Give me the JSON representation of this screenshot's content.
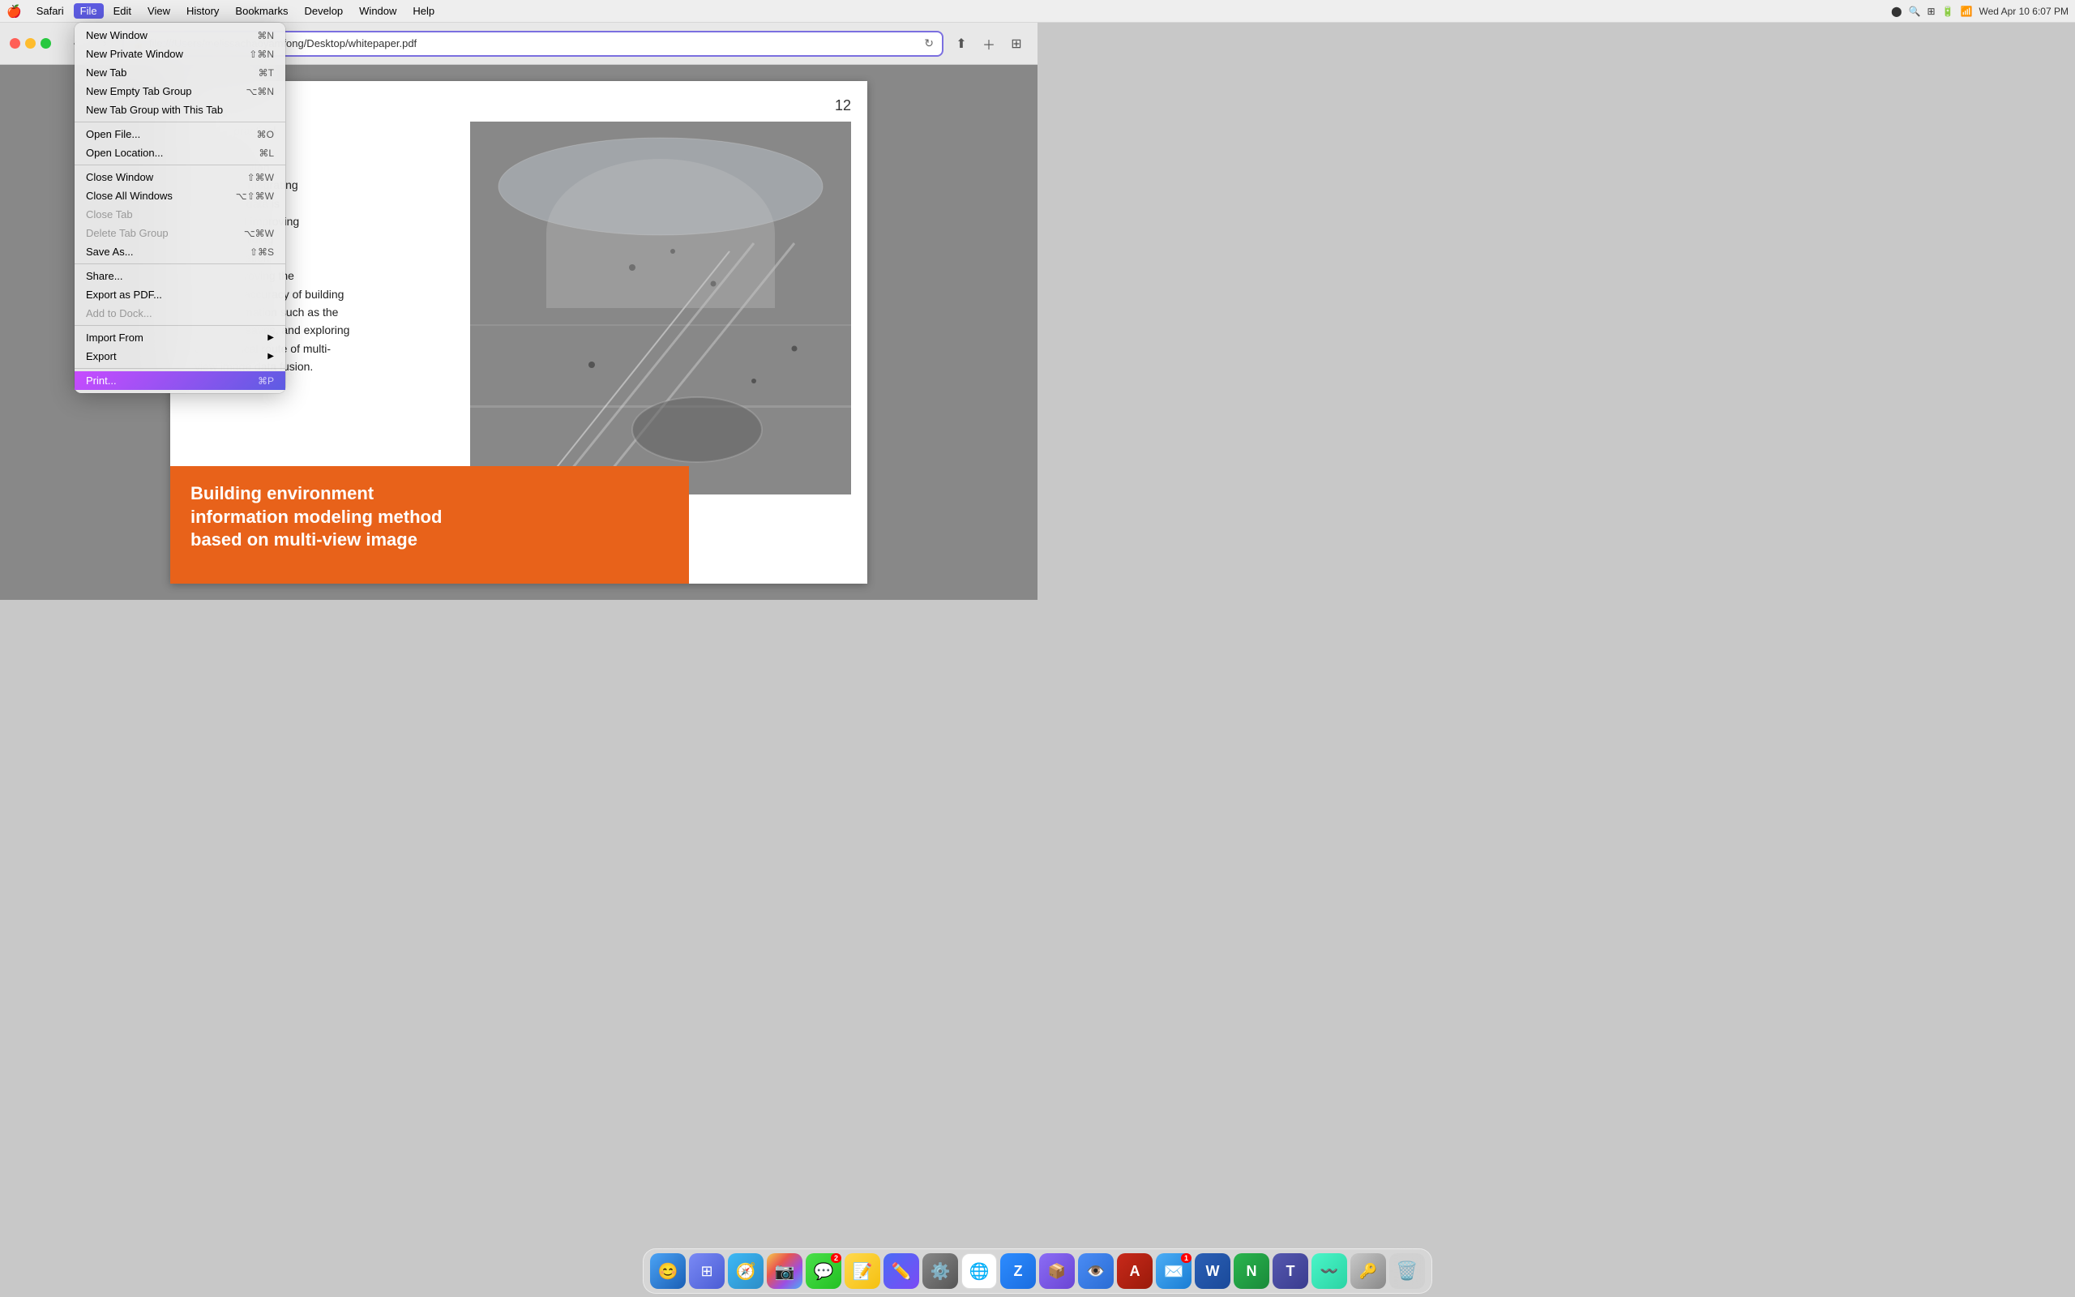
{
  "menubar": {
    "apple": "🍎",
    "items": [
      {
        "label": "Safari",
        "active": false
      },
      {
        "label": "File",
        "active": true
      },
      {
        "label": "Edit",
        "active": false
      },
      {
        "label": "View",
        "active": false
      },
      {
        "label": "History",
        "active": false
      },
      {
        "label": "Bookmarks",
        "active": false
      },
      {
        "label": "Develop",
        "active": false
      },
      {
        "label": "Window",
        "active": false
      },
      {
        "label": "Help",
        "active": false
      }
    ],
    "right": {
      "lastpass": "⬤",
      "wifi": "WiFi",
      "battery": "🔋",
      "time": "Wed Apr 10  6:07 PM"
    }
  },
  "titlebar": {
    "url": "file:///Users/melissachaoyamfong/Desktop/whitepaper.pdf",
    "url_icon": "🔒"
  },
  "pdf": {
    "page_number": "12",
    "left_text": "ed with practical\ne building\nent information\ng method integrating\new image data is\n, aiming at improving\nency of building\nent information\ng and improving the\nmodeling accuracy of building\nlocal information such as the\nbottom of eaves, and exploring\nthe technical route of multi-\nview image data fusion.",
    "banner_text": "Building environment\ninformation modeling method\nbased on multi-view image"
  },
  "file_menu": {
    "items": [
      {
        "label": "New Window",
        "shortcut": "⌘N",
        "disabled": false,
        "submenu": false
      },
      {
        "label": "New Private Window",
        "shortcut": "⇧⌘N",
        "disabled": false,
        "submenu": false
      },
      {
        "label": "New Tab",
        "shortcut": "⌘T",
        "disabled": false,
        "submenu": false
      },
      {
        "label": "New Empty Tab Group",
        "shortcut": "⌥⌘N",
        "disabled": false,
        "submenu": false
      },
      {
        "label": "New Tab Group with This Tab",
        "shortcut": "",
        "disabled": false,
        "submenu": false
      },
      {
        "separator": true
      },
      {
        "label": "Open File...",
        "shortcut": "⌘O",
        "disabled": false,
        "submenu": false
      },
      {
        "label": "Open Location...",
        "shortcut": "⌘L",
        "disabled": false,
        "submenu": false
      },
      {
        "separator": true
      },
      {
        "label": "Close Window",
        "shortcut": "⇧⌘W",
        "disabled": false,
        "submenu": false
      },
      {
        "label": "Close All Windows",
        "shortcut": "⌥⇧⌘W",
        "disabled": false,
        "submenu": false
      },
      {
        "label": "Close Tab",
        "shortcut": "",
        "disabled": true,
        "submenu": false
      },
      {
        "label": "Delete Tab Group",
        "shortcut": "⌥⌘W",
        "disabled": true,
        "submenu": false
      },
      {
        "label": "Save As...",
        "shortcut": "⇧⌘S",
        "disabled": false,
        "submenu": false
      },
      {
        "separator": true
      },
      {
        "label": "Share...",
        "shortcut": "",
        "disabled": false,
        "submenu": false
      },
      {
        "label": "Export as PDF...",
        "shortcut": "",
        "disabled": false,
        "submenu": false
      },
      {
        "label": "Add to Dock...",
        "shortcut": "",
        "disabled": true,
        "submenu": false
      },
      {
        "separator": true
      },
      {
        "label": "Import From",
        "shortcut": "",
        "disabled": false,
        "submenu": true
      },
      {
        "label": "Export",
        "shortcut": "",
        "disabled": false,
        "submenu": true
      },
      {
        "separator": true
      },
      {
        "label": "Print...",
        "shortcut": "⌘P",
        "disabled": false,
        "submenu": false,
        "highlighted": true
      }
    ]
  },
  "dock": {
    "icons": [
      {
        "name": "Finder",
        "emoji": "😊",
        "class": "finder",
        "badge": null
      },
      {
        "name": "Launchpad",
        "emoji": "⚏",
        "class": "launchpad",
        "badge": null
      },
      {
        "name": "Safari",
        "emoji": "🧭",
        "class": "safari",
        "badge": null
      },
      {
        "name": "Photos",
        "emoji": "📷",
        "class": "photos",
        "badge": null
      },
      {
        "name": "Messages",
        "emoji": "💬",
        "class": "messages",
        "badge": "2"
      },
      {
        "name": "Notes",
        "emoji": "📝",
        "class": "notes",
        "badge": null
      },
      {
        "name": "Freeform",
        "emoji": "✏️",
        "class": "freeform",
        "badge": null
      },
      {
        "name": "System Preferences",
        "emoji": "⚙️",
        "class": "sysprefs",
        "badge": null
      },
      {
        "name": "Chrome",
        "emoji": "🌐",
        "class": "chrome",
        "badge": null
      },
      {
        "name": "Zoom",
        "emoji": "📹",
        "class": "zoom-app",
        "badge": null
      },
      {
        "name": "Mua",
        "emoji": "📦",
        "class": "mua",
        "badge": null
      },
      {
        "name": "Preview",
        "emoji": "👁️",
        "class": "preview",
        "badge": null
      },
      {
        "name": "Acrobat",
        "emoji": "📄",
        "class": "acrobat",
        "badge": null
      },
      {
        "name": "Mail",
        "emoji": "✉️",
        "class": "mail",
        "badge": "1"
      },
      {
        "name": "Word",
        "emoji": "W",
        "class": "word",
        "badge": null
      },
      {
        "name": "Numbers",
        "emoji": "N",
        "class": "numbers",
        "badge": null
      },
      {
        "name": "Teams",
        "emoji": "T",
        "class": "teams",
        "badge": null
      },
      {
        "name": "WakaTime",
        "emoji": "〰",
        "class": "wakatime",
        "badge": null
      },
      {
        "name": "Keychain",
        "emoji": "🔑",
        "class": "keychain",
        "badge": null
      },
      {
        "name": "Trash",
        "emoji": "🗑️",
        "class": "trash",
        "badge": null
      }
    ]
  }
}
